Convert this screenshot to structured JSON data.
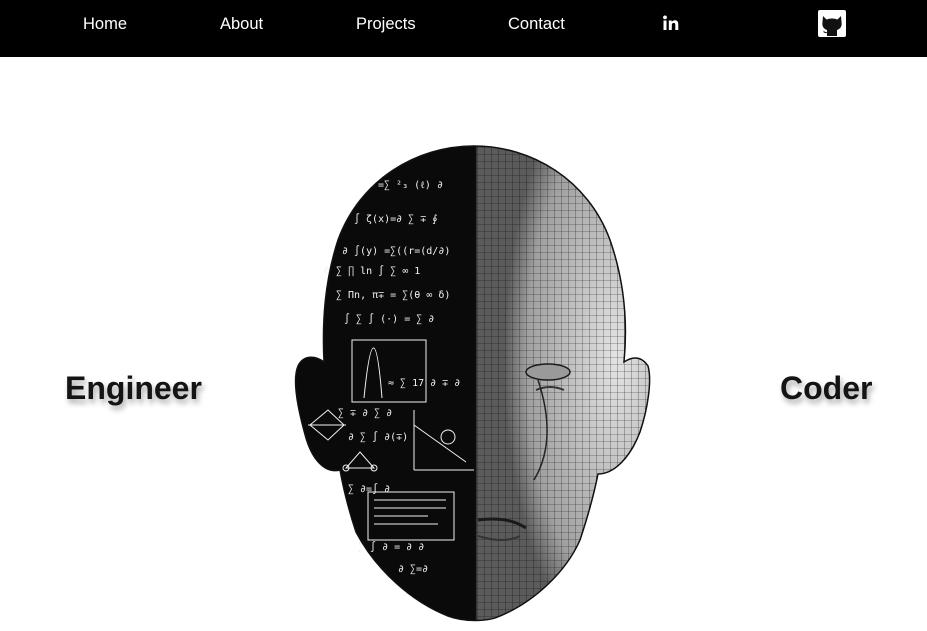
{
  "nav": {
    "links": [
      {
        "label": "Home"
      },
      {
        "label": "About"
      },
      {
        "label": "Projects"
      },
      {
        "label": "Contact"
      }
    ],
    "icons": [
      "linkedin-icon",
      "github-icon"
    ]
  },
  "hero": {
    "left_text": "Engineer",
    "right_text": "Coder",
    "image": "half-equations-half-wireframe-head-image"
  },
  "colors": {
    "navbar": "#000000",
    "background": "#ffffff",
    "text": "#141414",
    "nav_text": "#ffffff"
  }
}
